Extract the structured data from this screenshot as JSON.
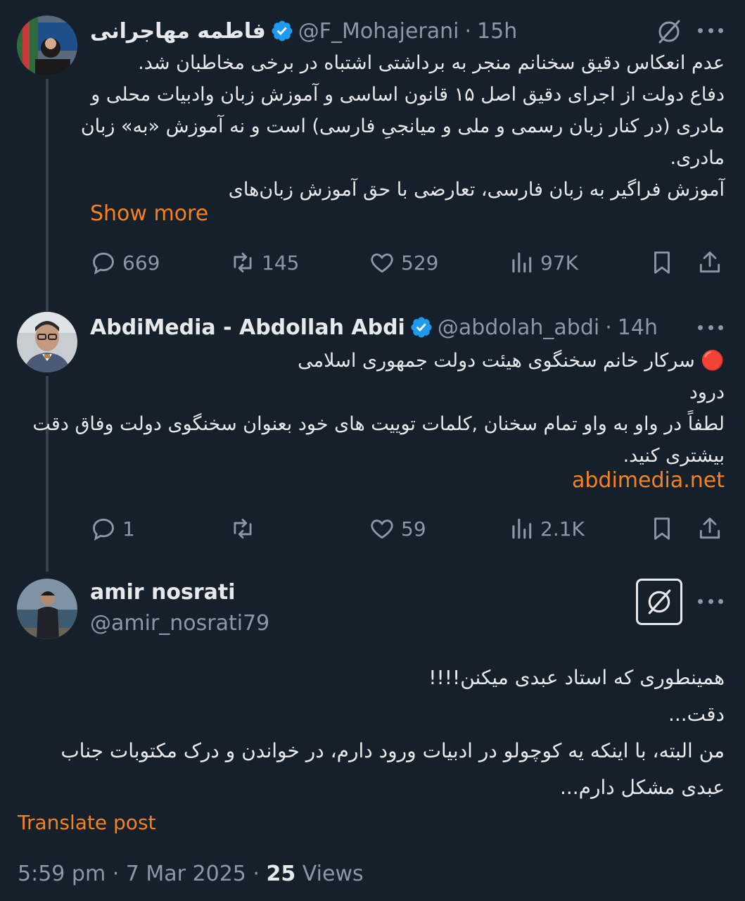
{
  "colors": {
    "background": "#15202b",
    "accent": "#f4821f",
    "verified": "#1d9bf0",
    "muted": "#8b98a5"
  },
  "tweet1": {
    "name": "فاطمه مهاجرانی",
    "handle": "@F_Mohajerani",
    "time": "15h",
    "lines": [
      "عدم انعکاس دقیق سخنانم منجر به برداشتی اشتباه در برخی مخاطبان شد.",
      "دفاع دولت از اجرای دقیق اصل ۱۵ قانون اساسی و آموزش زبان وادبیات محلی و",
      "مادری (در کنار زبان رسمی و ملی و میانجیِ فارسی) است و نه آموزش «به» زبان",
      "مادری.",
      "آموزش فراگیر به زبان فارسی، تعارضی با حق آموزش زبان‌های"
    ],
    "show_more": "Show more",
    "replies": "669",
    "reposts": "145",
    "likes": "529",
    "views": "97K"
  },
  "tweet2": {
    "name": "AbdiMedia - Abdollah Abdi",
    "handle": "@abdolah_abdi",
    "time": "14h",
    "lines": [
      "🔴 سرکار خانم سخنگوی هیئت دولت جمهوری اسلامی",
      "درود",
      "لطفاً در واو به واو تمام سخنان ,کلمات توییت های خود بعنوان سخنگوی دولت وفاق دقت",
      "بیشتری کنید."
    ],
    "link": "abdimedia.net",
    "replies": "1",
    "reposts": "",
    "likes": "59",
    "views": "2.1K"
  },
  "tweet3": {
    "name": "amir nosrati",
    "handle": "@amir_nosrati79",
    "lines": [
      "همینطوری که استاد عبدی میکنن!!!!",
      "دقت...",
      "من البته، با اینکه یه کوچولو در ادبیات ورود دارم، در خواندن و درک مکتوبات جناب",
      "عبدی مشکل دارم..."
    ],
    "translate": "Translate post",
    "timestamp": "5:59 pm · 7 Mar 2025 · ",
    "view_count": "25",
    "views_label": " Views"
  },
  "icons": [
    "grok-icon",
    "more-icon",
    "reply-icon",
    "repost-icon",
    "like-icon",
    "views-icon",
    "bookmark-icon",
    "share-icon",
    "verified-icon"
  ]
}
